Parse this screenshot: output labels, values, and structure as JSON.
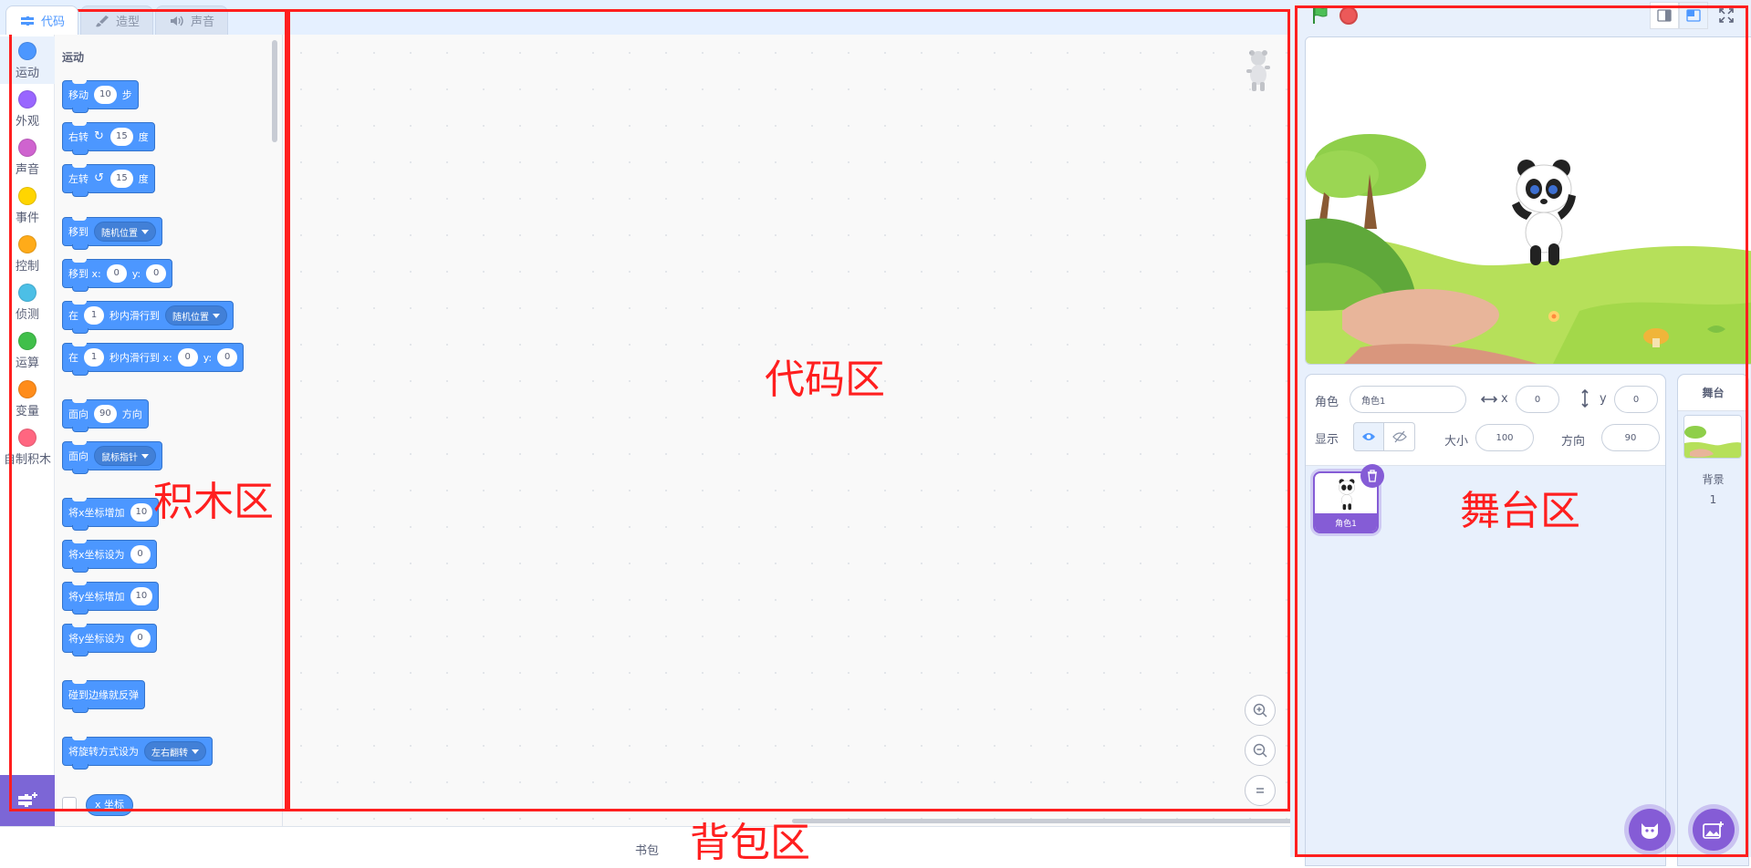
{
  "tabs": [
    {
      "label": "代码",
      "icon": "code-icon",
      "active": true
    },
    {
      "label": "造型",
      "icon": "brush-icon",
      "active": false
    },
    {
      "label": "声音",
      "icon": "speaker-icon",
      "active": false
    }
  ],
  "categories": [
    {
      "label": "运动",
      "color": "#4c97ff"
    },
    {
      "label": "外观",
      "color": "#9966ff"
    },
    {
      "label": "声音",
      "color": "#cf63cf"
    },
    {
      "label": "事件",
      "color": "#ffd500"
    },
    {
      "label": "控制",
      "color": "#ffab19"
    },
    {
      "label": "侦测",
      "color": "#4cbfe6"
    },
    {
      "label": "运算",
      "color": "#40bf4a"
    },
    {
      "label": "变量",
      "color": "#ff8c1a"
    },
    {
      "label": "自制积木",
      "color": "#ff6680"
    }
  ],
  "palette": {
    "title": "运动",
    "blocks": {
      "move": {
        "label": "移动",
        "value": "10",
        "suffix": "步"
      },
      "turn_right": {
        "label": "右转",
        "value": "15",
        "suffix": "度"
      },
      "turn_left": {
        "label": "左转",
        "value": "15",
        "suffix": "度"
      },
      "goto": {
        "label": "移到",
        "dropdown": "随机位置"
      },
      "goto_xy": {
        "label": "移到 x:",
        "x": "0",
        "ylabel": "y:",
        "y": "0"
      },
      "glide_to": {
        "label": "在",
        "secs": "1",
        "middle": "秒内滑行到",
        "dropdown": "随机位置"
      },
      "glide_xy": {
        "label": "在",
        "secs": "1",
        "middle": "秒内滑行到 x:",
        "x": "0",
        "ylabel": "y:",
        "y": "0"
      },
      "point_dir": {
        "label": "面向",
        "value": "90",
        "suffix": "方向"
      },
      "point_towards": {
        "label": "面向",
        "dropdown": "鼠标指针"
      },
      "change_x": {
        "label": "将x坐标增加",
        "value": "10"
      },
      "set_x": {
        "label": "将x坐标设为",
        "value": "0"
      },
      "change_y": {
        "label": "将y坐标增加",
        "value": "10"
      },
      "set_y": {
        "label": "将y坐标设为",
        "value": "0"
      },
      "bounce": {
        "label": "碰到边缘就反弹"
      },
      "rotation_style": {
        "label": "将旋转方式设为",
        "dropdown": "左右翻转"
      },
      "x_position": {
        "label": "x 坐标"
      }
    }
  },
  "backpack": {
    "label": "书包"
  },
  "sprite_info": {
    "sprite_label": "角色",
    "sprite_name": "角色1",
    "x_label": "x",
    "x_value": "0",
    "y_label": "y",
    "y_value": "0",
    "show_label": "显示",
    "size_label": "大小",
    "size_value": "100",
    "direction_label": "方向",
    "direction_value": "90"
  },
  "sprites": [
    {
      "name": "角色1"
    }
  ],
  "stage_panel": {
    "title": "舞台",
    "backdrop_label": "背景",
    "backdrop_count": "1"
  },
  "annotations": {
    "blocks_area": "积木区",
    "code_area": "代码区",
    "stage_area": "舞台区",
    "backpack_area": "背包区"
  },
  "colors": {
    "motion": "#4c97ff",
    "annotation": "#ff1f1f",
    "accent_purple": "#855cd6",
    "stop_red": "#ec5959",
    "flag_green": "#4cbf56"
  }
}
